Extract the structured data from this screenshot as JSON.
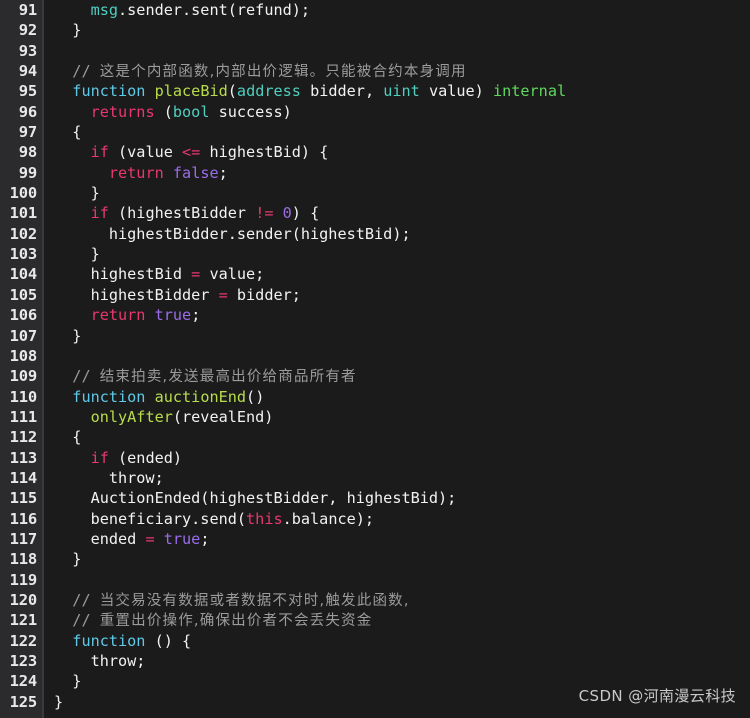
{
  "editor": {
    "language": "solidity",
    "theme_background": "#1b1b1b",
    "gutter_background": "#2b2b2d",
    "first_line_number": 91,
    "last_line_number": 125,
    "colors": {
      "plain_text": "#f2f2f2",
      "comment": "#9b9b9b",
      "keyword": "#5fc9e8",
      "function_name": "#b9dd4a",
      "type": "#4ecfc0",
      "modifier": "#5fd85f",
      "control": "#e8386f",
      "operator": "#e8386f",
      "constant": "#9b6ce8",
      "line_number": "#e8e8e8"
    }
  },
  "watermark": {
    "text": "CSDN @河南漫云科技"
  },
  "lines": [
    {
      "number": "91",
      "tokens": [
        {
          "t": "    ",
          "c": "plain"
        },
        {
          "t": "msg",
          "c": "type"
        },
        {
          "t": ".sender.sent(refund);",
          "c": "plain"
        }
      ]
    },
    {
      "number": "92",
      "tokens": [
        {
          "t": "  }",
          "c": "plain"
        }
      ]
    },
    {
      "number": "93",
      "tokens": []
    },
    {
      "number": "94",
      "tokens": [
        {
          "t": "  ",
          "c": "plain"
        },
        {
          "t": "// ",
          "c": "comment-slash"
        },
        {
          "t": "这是个内部函数,内部出价逻辑。只能被合约本身调用",
          "c": "comment"
        }
      ]
    },
    {
      "number": "95",
      "tokens": [
        {
          "t": "  ",
          "c": "plain"
        },
        {
          "t": "function",
          "c": "keyword"
        },
        {
          "t": " ",
          "c": "plain"
        },
        {
          "t": "placeBid",
          "c": "func"
        },
        {
          "t": "(",
          "c": "plain"
        },
        {
          "t": "address",
          "c": "type"
        },
        {
          "t": " bidder, ",
          "c": "plain"
        },
        {
          "t": "uint",
          "c": "type"
        },
        {
          "t": " value) ",
          "c": "plain"
        },
        {
          "t": "internal",
          "c": "modifier"
        }
      ]
    },
    {
      "number": "96",
      "tokens": [
        {
          "t": "    ",
          "c": "plain"
        },
        {
          "t": "returns",
          "c": "control"
        },
        {
          "t": " (",
          "c": "plain"
        },
        {
          "t": "bool",
          "c": "type"
        },
        {
          "t": " success)",
          "c": "plain"
        }
      ]
    },
    {
      "number": "97",
      "tokens": [
        {
          "t": "  {",
          "c": "plain"
        }
      ]
    },
    {
      "number": "98",
      "tokens": [
        {
          "t": "    ",
          "c": "plain"
        },
        {
          "t": "if",
          "c": "control"
        },
        {
          "t": " (value ",
          "c": "plain"
        },
        {
          "t": "<=",
          "c": "operator"
        },
        {
          "t": " highestBid) {",
          "c": "plain"
        }
      ]
    },
    {
      "number": "99",
      "tokens": [
        {
          "t": "      ",
          "c": "plain"
        },
        {
          "t": "return",
          "c": "control"
        },
        {
          "t": " ",
          "c": "plain"
        },
        {
          "t": "false",
          "c": "const"
        },
        {
          "t": ";",
          "c": "plain"
        }
      ]
    },
    {
      "number": "100",
      "tokens": [
        {
          "t": "    }",
          "c": "plain"
        }
      ]
    },
    {
      "number": "101",
      "tokens": [
        {
          "t": "    ",
          "c": "plain"
        },
        {
          "t": "if",
          "c": "control"
        },
        {
          "t": " (highestBidder ",
          "c": "plain"
        },
        {
          "t": "!=",
          "c": "operator"
        },
        {
          "t": " ",
          "c": "plain"
        },
        {
          "t": "0",
          "c": "const"
        },
        {
          "t": ") {",
          "c": "plain"
        }
      ]
    },
    {
      "number": "102",
      "tokens": [
        {
          "t": "      highestBidder.sender(highestBid);",
          "c": "plain"
        }
      ]
    },
    {
      "number": "103",
      "tokens": [
        {
          "t": "    }",
          "c": "plain"
        }
      ]
    },
    {
      "number": "104",
      "tokens": [
        {
          "t": "    highestBid ",
          "c": "plain"
        },
        {
          "t": "=",
          "c": "operator"
        },
        {
          "t": " value;",
          "c": "plain"
        }
      ]
    },
    {
      "number": "105",
      "tokens": [
        {
          "t": "    highestBidder ",
          "c": "plain"
        },
        {
          "t": "=",
          "c": "operator"
        },
        {
          "t": " bidder;",
          "c": "plain"
        }
      ]
    },
    {
      "number": "106",
      "tokens": [
        {
          "t": "    ",
          "c": "plain"
        },
        {
          "t": "return",
          "c": "control"
        },
        {
          "t": " ",
          "c": "plain"
        },
        {
          "t": "true",
          "c": "const"
        },
        {
          "t": ";",
          "c": "plain"
        }
      ]
    },
    {
      "number": "107",
      "tokens": [
        {
          "t": "  }",
          "c": "plain"
        }
      ]
    },
    {
      "number": "108",
      "tokens": []
    },
    {
      "number": "109",
      "tokens": [
        {
          "t": "  ",
          "c": "plain"
        },
        {
          "t": "// ",
          "c": "comment-slash"
        },
        {
          "t": "结束拍卖,发送最高出价给商品所有者",
          "c": "comment"
        }
      ]
    },
    {
      "number": "110",
      "tokens": [
        {
          "t": "  ",
          "c": "plain"
        },
        {
          "t": "function",
          "c": "keyword"
        },
        {
          "t": " ",
          "c": "plain"
        },
        {
          "t": "auctionEnd",
          "c": "func"
        },
        {
          "t": "()",
          "c": "plain"
        }
      ]
    },
    {
      "number": "111",
      "tokens": [
        {
          "t": "    ",
          "c": "plain"
        },
        {
          "t": "onlyAfter",
          "c": "func"
        },
        {
          "t": "(revealEnd)",
          "c": "plain"
        }
      ]
    },
    {
      "number": "112",
      "tokens": [
        {
          "t": "  {",
          "c": "plain"
        }
      ]
    },
    {
      "number": "113",
      "tokens": [
        {
          "t": "    ",
          "c": "plain"
        },
        {
          "t": "if",
          "c": "control"
        },
        {
          "t": " (ended)",
          "c": "plain"
        }
      ]
    },
    {
      "number": "114",
      "tokens": [
        {
          "t": "      throw;",
          "c": "plain"
        }
      ]
    },
    {
      "number": "115",
      "tokens": [
        {
          "t": "    AuctionEnded(highestBidder, highestBid);",
          "c": "plain"
        }
      ]
    },
    {
      "number": "116",
      "tokens": [
        {
          "t": "    beneficiary.send(",
          "c": "plain"
        },
        {
          "t": "this",
          "c": "this"
        },
        {
          "t": ".balance);",
          "c": "plain"
        }
      ]
    },
    {
      "number": "117",
      "tokens": [
        {
          "t": "    ended ",
          "c": "plain"
        },
        {
          "t": "=",
          "c": "operator"
        },
        {
          "t": " ",
          "c": "plain"
        },
        {
          "t": "true",
          "c": "const"
        },
        {
          "t": ";",
          "c": "plain"
        }
      ]
    },
    {
      "number": "118",
      "tokens": [
        {
          "t": "  }",
          "c": "plain"
        }
      ]
    },
    {
      "number": "119",
      "tokens": []
    },
    {
      "number": "120",
      "tokens": [
        {
          "t": "  ",
          "c": "plain"
        },
        {
          "t": "// ",
          "c": "comment-slash"
        },
        {
          "t": "当交易没有数据或者数据不对时,触发此函数,",
          "c": "comment"
        }
      ]
    },
    {
      "number": "121",
      "tokens": [
        {
          "t": "  ",
          "c": "plain"
        },
        {
          "t": "// ",
          "c": "comment-slash"
        },
        {
          "t": "重置出价操作,确保出价者不会丢失资金",
          "c": "comment"
        }
      ]
    },
    {
      "number": "122",
      "tokens": [
        {
          "t": "  ",
          "c": "plain"
        },
        {
          "t": "function",
          "c": "keyword"
        },
        {
          "t": " () {",
          "c": "plain"
        }
      ]
    },
    {
      "number": "123",
      "tokens": [
        {
          "t": "    throw;",
          "c": "plain"
        }
      ]
    },
    {
      "number": "124",
      "tokens": [
        {
          "t": "  }",
          "c": "plain"
        }
      ]
    },
    {
      "number": "125",
      "tokens": [
        {
          "t": "}",
          "c": "plain"
        }
      ]
    }
  ]
}
